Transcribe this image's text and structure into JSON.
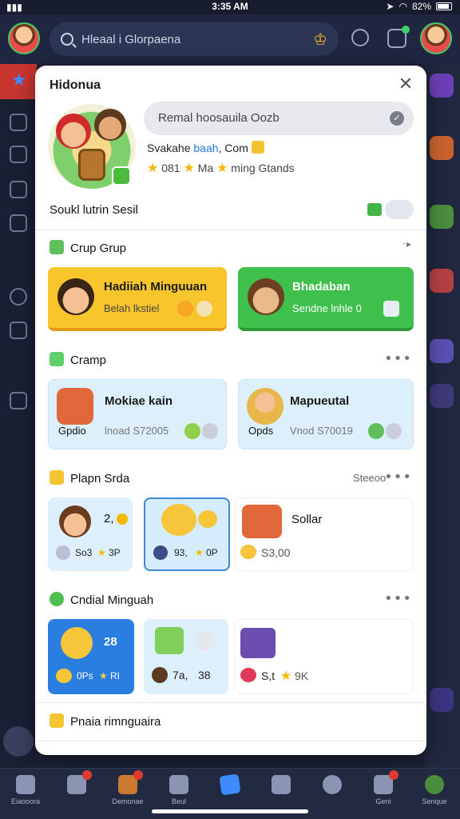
{
  "status": {
    "time": "3:35 AM",
    "battery": "82%"
  },
  "appbar": {
    "search_text": "Hleaal i Glorpaena"
  },
  "modal": {
    "title": "Hidonua",
    "name_pill": "Remal hoosauila Oozb",
    "subtitle_prefix": "Svakahe ",
    "subtitle_highlight": "baah",
    "subtitle_suffix": ", Com",
    "stats": {
      "a": "081",
      "b": "Ma",
      "c": "ming Gtands"
    },
    "section_social": "Soukl lutrin Sesil",
    "section_group": "Crup Grup",
    "card1": {
      "title": "Hadiiah Minguuan",
      "sub": "Belah lkstiel"
    },
    "card2": {
      "title": "Bhadaban",
      "sub": "Sendne lnhle 0"
    },
    "section_cramp": "Cramp",
    "card3": {
      "title": "Mokiae kain",
      "label": "Gpdio",
      "value": "lnoad S72005"
    },
    "card4": {
      "title": "Mapueutal",
      "label": "Opds",
      "value": "Vnod S70019"
    },
    "section_plan": "Plapn Srda",
    "plan_action": "Steeoo",
    "plan_tiles": [
      {
        "top": "2,",
        "bottom": "So3",
        "tag": "3P"
      },
      {
        "top": "",
        "bottom": "93,",
        "tag": "0P"
      },
      {
        "top": "Sollar",
        "bottom": "S3,00",
        "tag": ""
      }
    ],
    "section_weekly": "Cndial Minguah",
    "weekly_tiles": [
      {
        "top": "28",
        "bottom": "0Ps",
        "tag": "RI"
      },
      {
        "top": "",
        "bottom": "7a,",
        "tag": "38"
      },
      {
        "top": "",
        "bottom": "S,t",
        "tag": "9K"
      }
    ],
    "section_last": "Pnaia rimnguaira"
  },
  "bottomnav": [
    {
      "label": "Eiaooora"
    },
    {
      "label": ""
    },
    {
      "label": "Demonae"
    },
    {
      "label": "Beul"
    },
    {
      "label": ""
    },
    {
      "label": ""
    },
    {
      "label": ""
    },
    {
      "label": "Geni"
    },
    {
      "label": "Senque"
    }
  ]
}
